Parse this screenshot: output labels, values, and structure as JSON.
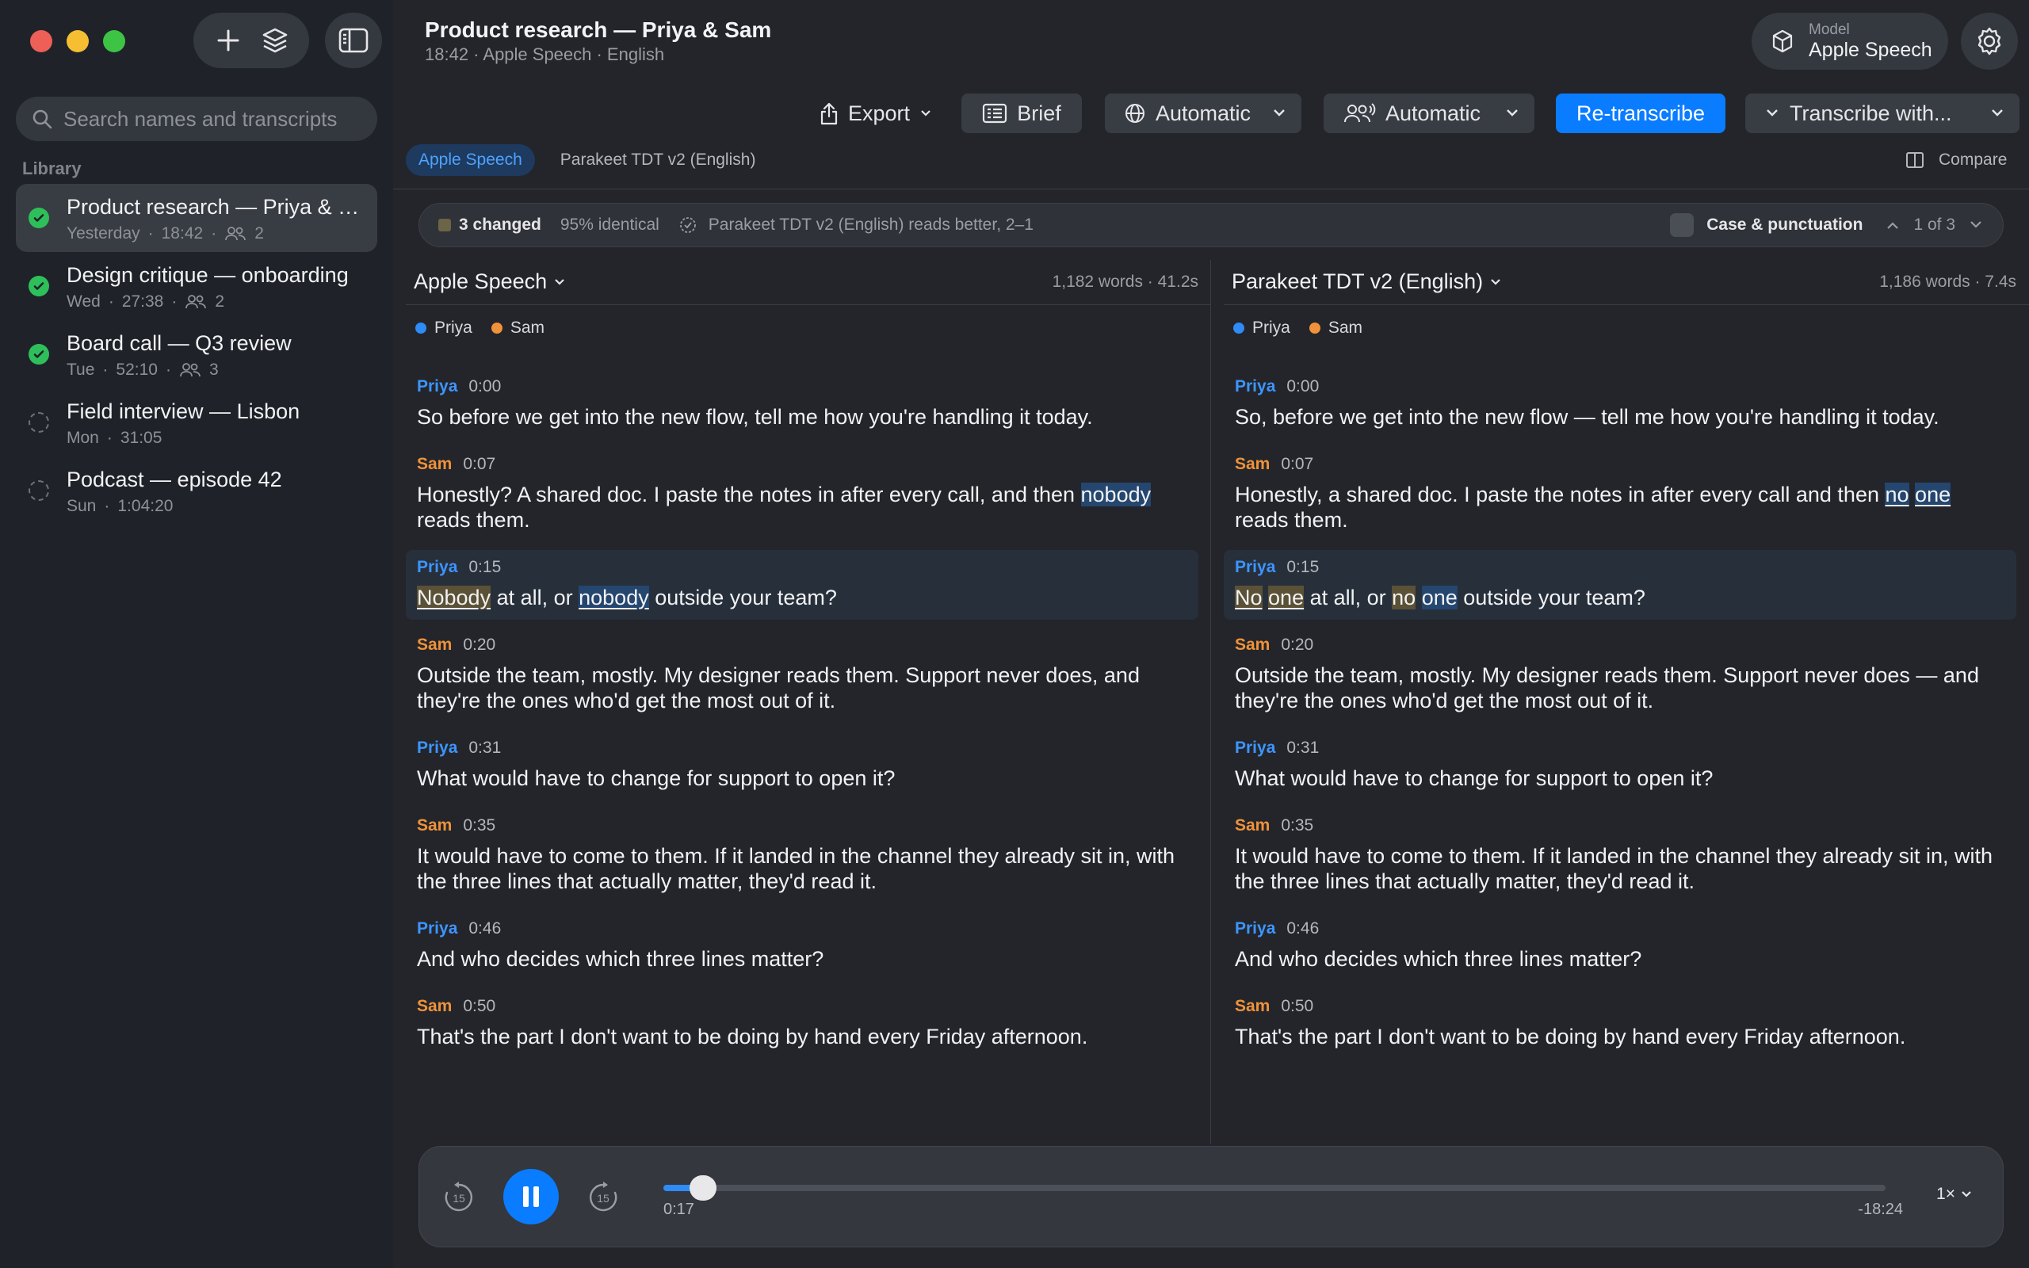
{
  "sidebar": {
    "search_placeholder": "Search names and transcripts",
    "library_label": "Library",
    "items": [
      {
        "title": "Product research — Priya & S...",
        "day": "Yesterday",
        "duration": "18:42",
        "people": "2",
        "status": "done",
        "active": true
      },
      {
        "title": "Design critique — onboarding",
        "day": "Wed",
        "duration": "27:38",
        "people": "2",
        "status": "done"
      },
      {
        "title": "Board call — Q3 review",
        "day": "Tue",
        "duration": "52:10",
        "people": "3",
        "status": "done"
      },
      {
        "title": "Field interview — Lisbon",
        "day": "Mon",
        "duration": "31:05",
        "status": "pending"
      },
      {
        "title": "Podcast — episode 42",
        "day": "Sun",
        "duration": "1:04:20",
        "status": "pending"
      }
    ]
  },
  "header": {
    "title": "Product research — Priya & Sam",
    "subtitle": "18:42 · Apple Speech · English",
    "model_label": "Model",
    "model_value": "Apple Speech"
  },
  "toolbar": {
    "export": "Export",
    "brief": "Brief",
    "language": "Automatic",
    "speakers": "Automatic",
    "retranscribe": "Re-transcribe",
    "transcribe_with": "Transcribe with..."
  },
  "tabs": {
    "items": [
      "Apple Speech",
      "Parakeet TDT v2 (English)"
    ],
    "compare": "Compare"
  },
  "diff": {
    "changed": "3 changed",
    "identical": "95% identical",
    "verdict": "Parakeet TDT v2 (English) reads better, 2–1",
    "case_punct": "Case & punctuation",
    "nav": "1 of 3"
  },
  "left": {
    "model": "Apple Speech",
    "stats": "1,182 words · 41.2s",
    "speakers": [
      "Priya",
      "Sam"
    ],
    "utterances": [
      {
        "speaker": "Priya",
        "time": "0:00",
        "text": "So before we get into the new flow, tell me how you're handling it today."
      },
      {
        "speaker": "Sam",
        "time": "0:07",
        "pre": "Honestly? A shared doc. I paste the notes in after every call, and then ",
        "mark": "nobody",
        "post": " reads them."
      },
      {
        "speaker": "Priya",
        "time": "0:15",
        "m1": "Nobody",
        "t1": " at all, or ",
        "m2": "nobody",
        "t2": " outside your team?"
      },
      {
        "speaker": "Sam",
        "time": "0:20",
        "text": "Outside the team, mostly. My designer reads them. Support never does, and they're the ones who'd get the most out of it."
      },
      {
        "speaker": "Priya",
        "time": "0:31",
        "text": "What would have to change for support to open it?"
      },
      {
        "speaker": "Sam",
        "time": "0:35",
        "text": "It would have to come to them. If it landed in the channel they already sit in, with the three lines that actually matter, they'd read it."
      },
      {
        "speaker": "Priya",
        "time": "0:46",
        "text": "And who decides which three lines matter?"
      },
      {
        "speaker": "Sam",
        "time": "0:50",
        "text": "That's the part I don't want to be doing by hand every Friday afternoon."
      }
    ]
  },
  "right": {
    "model": "Parakeet TDT v2 (English)",
    "stats": "1,186 words · 7.4s",
    "speakers": [
      "Priya",
      "Sam"
    ],
    "utterances": [
      {
        "speaker": "Priya",
        "time": "0:00",
        "text": "So, before we get into the new flow — tell me how you're handling it today."
      },
      {
        "speaker": "Sam",
        "time": "0:07",
        "pre": "Honestly, a shared doc. I paste the notes in after every call and then ",
        "mark1": "no",
        "mark2": "one",
        "post": " reads them."
      },
      {
        "speaker": "Priya",
        "time": "0:15",
        "m1": "No",
        "m2": "one",
        "t1": " at all, or ",
        "m3": "no",
        "m4": "one",
        "t2": " outside your team?"
      },
      {
        "speaker": "Sam",
        "time": "0:20",
        "text": "Outside the team, mostly. My designer reads them. Support never does — and they're the ones who'd get the most out of it."
      },
      {
        "speaker": "Priya",
        "time": "0:31",
        "text": "What would have to change for support to open it?"
      },
      {
        "speaker": "Sam",
        "time": "0:35",
        "text": "It would have to come to them. If it landed in the channel they already sit in, with the three lines that actually matter, they'd read it."
      },
      {
        "speaker": "Priya",
        "time": "0:46",
        "text": "And who decides which three lines matter?"
      },
      {
        "speaker": "Sam",
        "time": "0:50",
        "text": "That's the part I don't want to be doing by hand every Friday afternoon."
      }
    ]
  },
  "player": {
    "skip_back": "15",
    "skip_forward": "15",
    "current": "0:17",
    "remaining": "-18:24",
    "speed": "1×",
    "progress": 0.015
  },
  "colors": {
    "accent": "#0a7cff",
    "priya": "#3d95ff",
    "sam": "#f0923a",
    "done": "#2fbf5a"
  }
}
